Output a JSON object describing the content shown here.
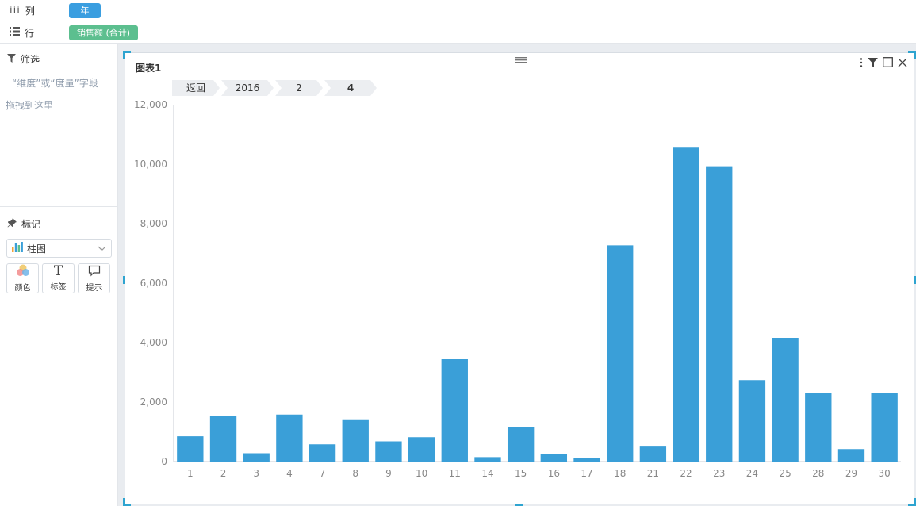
{
  "shelves": {
    "columns": {
      "label": "列",
      "pill": "年"
    },
    "rows": {
      "label": "行",
      "pill": "销售额 (合计)"
    }
  },
  "filter": {
    "title": "筛选",
    "hint_line1": "“维度”或“度量”字段",
    "hint_line2": "拖拽到这里"
  },
  "marks": {
    "title": "标记",
    "chart_type": "柱图",
    "buttons": {
      "color": "颜色",
      "label": "标签",
      "tooltip": "提示"
    }
  },
  "chart": {
    "title": "图表1",
    "breadcrumbs": [
      "返回",
      "2016",
      "2",
      "4"
    ]
  },
  "colors": {
    "bar": "#3a9fd8",
    "accent": "#2ea4d0",
    "pill_blue": "#3a9ee0",
    "pill_green": "#5cbf8f"
  },
  "chart_data": {
    "type": "bar",
    "categories": [
      "1",
      "2",
      "3",
      "4",
      "7",
      "8",
      "9",
      "10",
      "11",
      "14",
      "15",
      "16",
      "17",
      "18",
      "21",
      "22",
      "23",
      "24",
      "25",
      "28",
      "29",
      "30"
    ],
    "values": [
      850,
      1530,
      280,
      1580,
      580,
      1420,
      680,
      820,
      3440,
      150,
      1170,
      240,
      130,
      7270,
      530,
      10580,
      9930,
      2740,
      4160,
      2320,
      420,
      2320
    ],
    "ylim": [
      0,
      12000
    ],
    "yticks": [
      "0",
      "2,000",
      "4,000",
      "6,000",
      "8,000",
      "10,000",
      "12,000"
    ],
    "title": "",
    "xlabel": "",
    "ylabel": "",
    "grid": false
  }
}
